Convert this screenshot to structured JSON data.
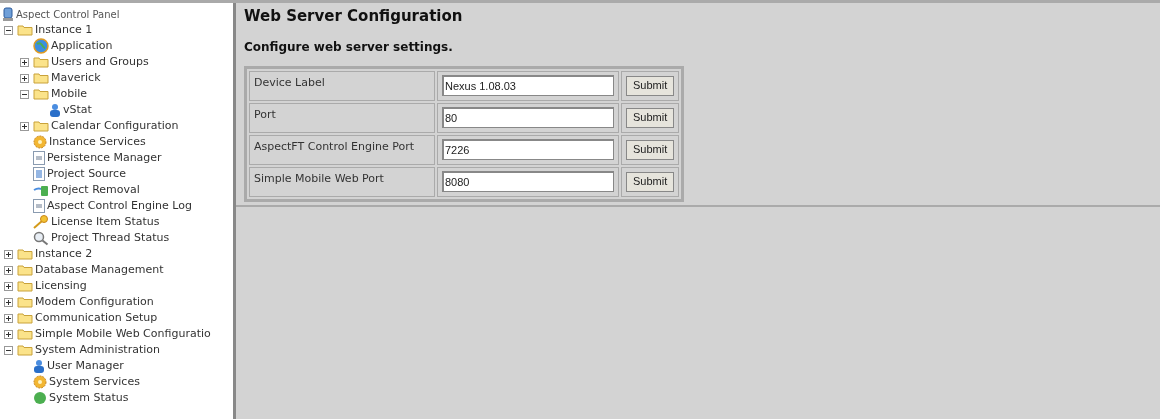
{
  "tree": {
    "label": "Aspect Control Panel",
    "kind": "panel",
    "children": [
      {
        "label": "Instance 1",
        "kind": "folder",
        "expanded": true,
        "children": [
          {
            "label": "Application",
            "kind": "globe"
          },
          {
            "label": "Users and Groups",
            "kind": "folder",
            "expanded": false
          },
          {
            "label": "Maverick",
            "kind": "folder",
            "expanded": false
          },
          {
            "label": "Mobile",
            "kind": "folder",
            "expanded": true,
            "children": [
              {
                "label": "vStat",
                "kind": "user"
              }
            ]
          },
          {
            "label": "Calendar Configuration",
            "kind": "folder",
            "expanded": false
          },
          {
            "label": "Instance Services",
            "kind": "gear"
          },
          {
            "label": "Persistence Manager",
            "kind": "document"
          },
          {
            "label": "Project Source",
            "kind": "list"
          },
          {
            "label": "Project Removal",
            "kind": "removal"
          },
          {
            "label": "Aspect Control Engine Log",
            "kind": "document"
          },
          {
            "label": "License Item Status",
            "kind": "key"
          },
          {
            "label": "Project Thread Status",
            "kind": "magnifier"
          }
        ]
      },
      {
        "label": "Instance 2",
        "kind": "folder",
        "expanded": false
      },
      {
        "label": "Database Management",
        "kind": "folder",
        "expanded": false
      },
      {
        "label": "Licensing",
        "kind": "folder",
        "expanded": false
      },
      {
        "label": "Modem Configuration",
        "kind": "folder",
        "expanded": false
      },
      {
        "label": "Communication Setup",
        "kind": "folder",
        "expanded": false
      },
      {
        "label": "Simple Mobile Web Configuratio",
        "kind": "folder",
        "expanded": false
      },
      {
        "label": "System Administration",
        "kind": "folder",
        "expanded": true,
        "children": [
          {
            "label": "User Manager",
            "kind": "user"
          },
          {
            "label": "System Services",
            "kind": "gear"
          },
          {
            "label": "System Status",
            "kind": "status"
          }
        ]
      }
    ]
  },
  "page": {
    "title": "Web Server Configuration",
    "subtitle": "Configure web server settings.",
    "rows": [
      {
        "label": "Device Label",
        "value": "Nexus 1.08.03",
        "button": "Submit"
      },
      {
        "label": "Port",
        "value": "80",
        "button": "Submit"
      },
      {
        "label": "AspectFT Control Engine Port",
        "value": "7226",
        "button": "Submit"
      },
      {
        "label": "Simple Mobile Web Port",
        "value": "8080",
        "button": "Submit"
      }
    ]
  }
}
